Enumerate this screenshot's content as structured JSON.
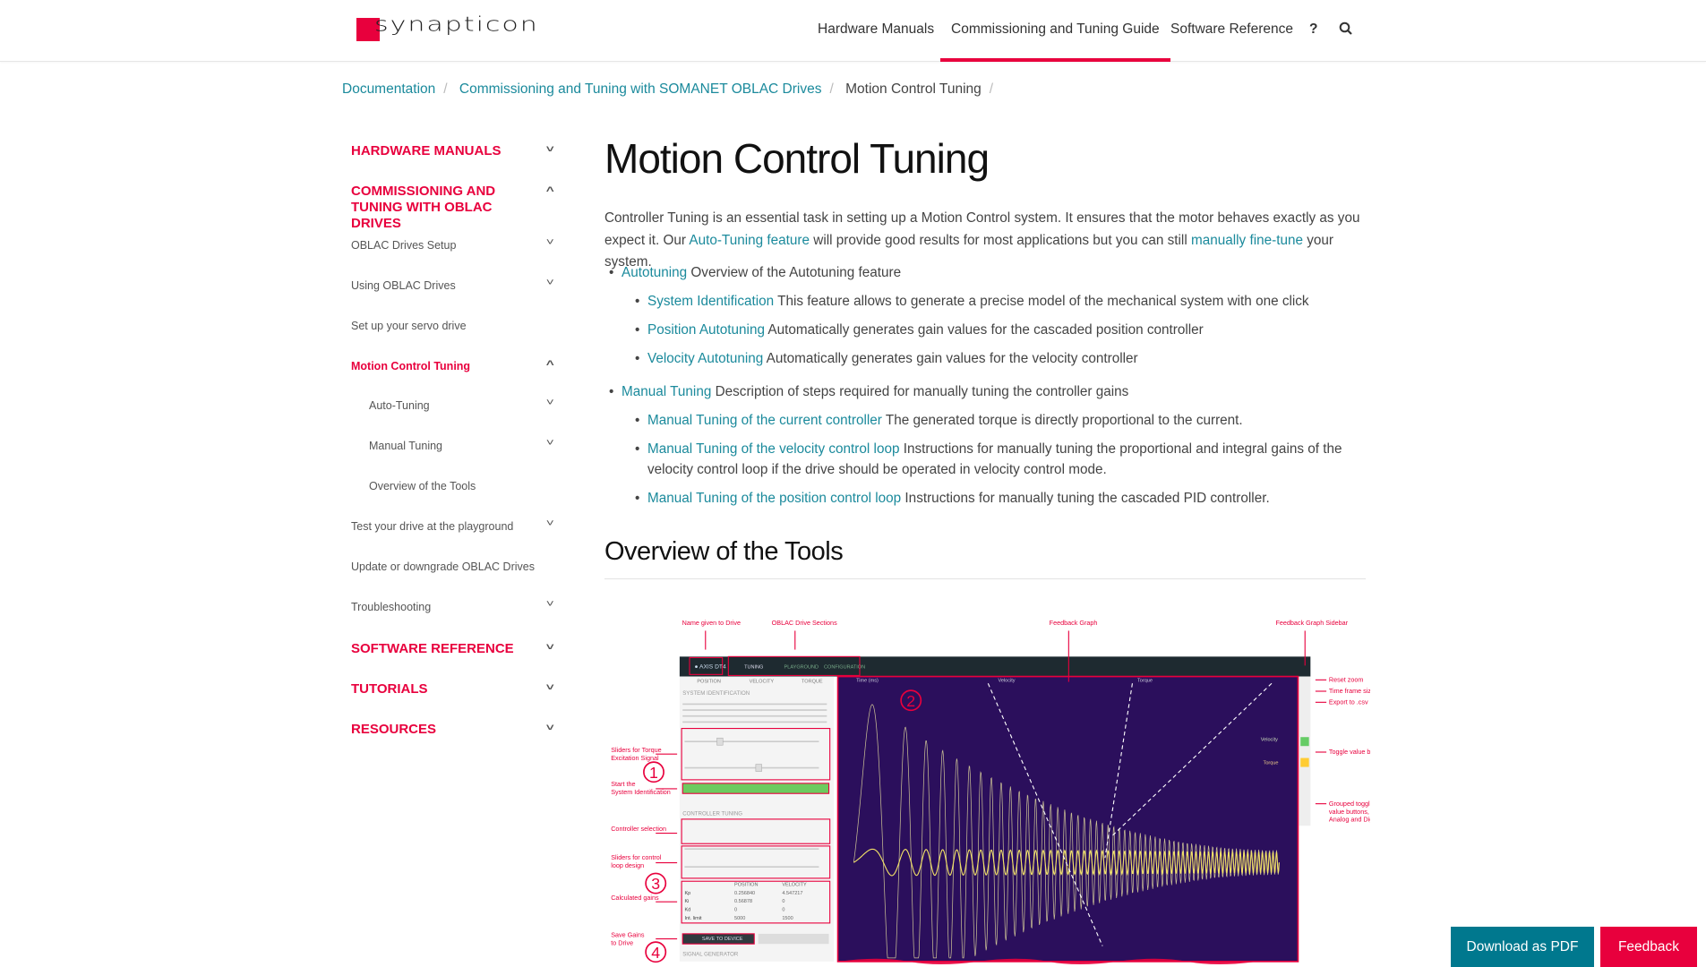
{
  "brand": {
    "name": "synapticon",
    "accent": "#e8003d",
    "link": "#1b8a9c"
  },
  "nav": {
    "items": [
      {
        "label": "Hardware Manuals"
      },
      {
        "label": "Commissioning and Tuning Guide",
        "active": true
      },
      {
        "label": "Software Reference"
      }
    ],
    "help_icon": "?",
    "search_icon": "search-icon"
  },
  "breadcrumb": [
    "Documentation",
    "Commissioning and Tuning with SOMANET OBLAC Drives",
    "Motion Control Tuning"
  ],
  "sidebar": {
    "items": [
      {
        "label": "HARDWARE MANUALS",
        "chev": "˅"
      },
      {
        "label": "COMMISSIONING AND TUNING WITH OBLAC DRIVES",
        "chev": "˄"
      },
      {
        "label": "OBLAC Drives Setup",
        "chev": "˅"
      },
      {
        "label": "Using OBLAC Drives",
        "chev": "˅"
      },
      {
        "label": "Set up your servo drive"
      },
      {
        "label": "Motion Control Tuning",
        "chev": "˄"
      },
      {
        "label": "Auto-Tuning",
        "chev": "˅"
      },
      {
        "label": "Manual Tuning",
        "chev": "˅"
      },
      {
        "label": "Overview of the Tools"
      },
      {
        "label": "Test your drive at the playground",
        "chev": "˅"
      },
      {
        "label": "Update or downgrade OBLAC Drives"
      },
      {
        "label": "Troubleshooting",
        "chev": "˅"
      },
      {
        "label": "SOFTWARE REFERENCE",
        "chev": "˅"
      },
      {
        "label": "TUTORIALS",
        "chev": "˅"
      },
      {
        "label": "RESOURCES",
        "chev": "˅"
      }
    ]
  },
  "content": {
    "title": "Motion Control Tuning",
    "intro": {
      "t1": "Controller Tuning is an essential task in setting up a Motion Control system. It ensures that the motor behaves exactly as you expect it. Our ",
      "l1": "Auto-Tuning feature",
      "t2": " will provide good results for most applications but you can still ",
      "l2": "manually fine-tune",
      "t3": " your system."
    },
    "list": [
      {
        "link": "Autotuning",
        "text": " Overview of the Autotuning feature"
      },
      {
        "link": "System Identification",
        "text": " This feature allows to generate a precise model of the mechanical system with one click"
      },
      {
        "link": "Position Autotuning",
        "text": " Automatically generates gain values for the cascaded position controller"
      },
      {
        "link": "Velocity Autotuning",
        "text": " Automatically generates gain values for the velocity controller"
      },
      {
        "link": "Manual Tuning",
        "text": " Description of steps required for manually tuning the controller gains"
      },
      {
        "link": "Manual Tuning of the current controller",
        "text": " The generated torque is directly proportional to the current."
      },
      {
        "link": "Manual Tuning of the velocity control loop",
        "text": " Instructions for manually tuning the proportional and integral gains of the velocity control loop if the drive should be operated in velocity control mode."
      },
      {
        "link": "Manual Tuning of the position control loop",
        "text": " Instructions for manually tuning the cascaded PID controller."
      }
    ],
    "h2": "Overview of the Tools"
  },
  "figure": {
    "annotations_top": [
      "Name given to Drive",
      "OBLAC Drive Sections",
      "Feedback Graph",
      "Feedback Graph Sidebar"
    ],
    "annotations_left": [
      "Sliders for Torque Excitation Signal",
      "Start the System Identification",
      "Controller selection",
      "Sliders for control loop design",
      "Calculated gains",
      "Save Gains to Drive"
    ],
    "annotations_right": [
      "Reset zoom",
      "Time frame size",
      "Export to .csv",
      "Toggle value button",
      "Grouped toggle value buttons, Analog and Digital Inputs"
    ],
    "numbers": [
      "1",
      "2",
      "3",
      "4"
    ],
    "tabs": [
      "TUNING",
      "PLAYGROUND",
      "CONFIGURATION"
    ],
    "drive": "AXIS DT4",
    "subtabs": [
      "POSITION",
      "VELOCITY",
      "TORQUE"
    ],
    "sections": [
      "SYSTEM IDENTIFICATION",
      "CONTROLLER TUNING",
      "SIGNAL GENERATOR"
    ],
    "save_label": "SAVE TO DEVICE",
    "gains_header": [
      "POSITION",
      "VELOCITY"
    ],
    "gains": [
      [
        "Kp",
        "0.256840",
        "4.547217"
      ],
      [
        "Ki",
        "0.56878",
        "0"
      ],
      [
        "Kd",
        "0",
        "0"
      ],
      [
        "Int. limit",
        "5000",
        "1500"
      ]
    ],
    "graph_header": [
      "Time (ms)",
      "Velocity",
      "Torque"
    ],
    "series_labels": [
      "Velocity",
      "Torque"
    ],
    "colors": {
      "graph_bg": "#2b0f5c",
      "wave": "#e8e0a0",
      "annot": "#e8003d",
      "bar": "#1e2a30"
    }
  },
  "buttons": {
    "pdf": "Download as PDF",
    "feedback": "Feedback"
  }
}
